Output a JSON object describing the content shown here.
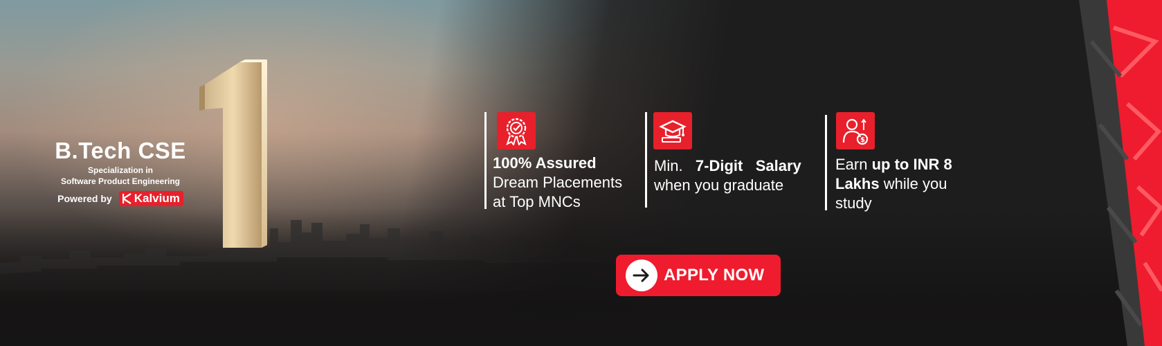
{
  "brand": {
    "title": "B.Tech CSE",
    "subtitle_line1": "Specialization in",
    "subtitle_line2": "Software Product Engineering",
    "powered_by": "Powered by",
    "partner": "Kalvium"
  },
  "hero": {
    "numeral": "1"
  },
  "features": [
    {
      "icon": "award-badge-icon",
      "bold": "100% Assured",
      "line2": "Dream Placements",
      "line3": "at Top MNCs"
    },
    {
      "icon": "graduation-cap-icon",
      "pre": "Min.",
      "bold1": "7-Digit",
      "bold2": "Salary",
      "line2": "when you graduate"
    },
    {
      "icon": "earning-person-icon",
      "pre": "Earn",
      "bold1": "up to INR 8",
      "bold2": "Lakhs",
      "post": "while you",
      "line3": "study"
    }
  ],
  "cta": {
    "label": "APPLY NOW",
    "icon": "arrow-right-icon"
  },
  "colors": {
    "accent": "#ee1c2e",
    "background": "#1e1d1d",
    "text": "#ffffff"
  }
}
